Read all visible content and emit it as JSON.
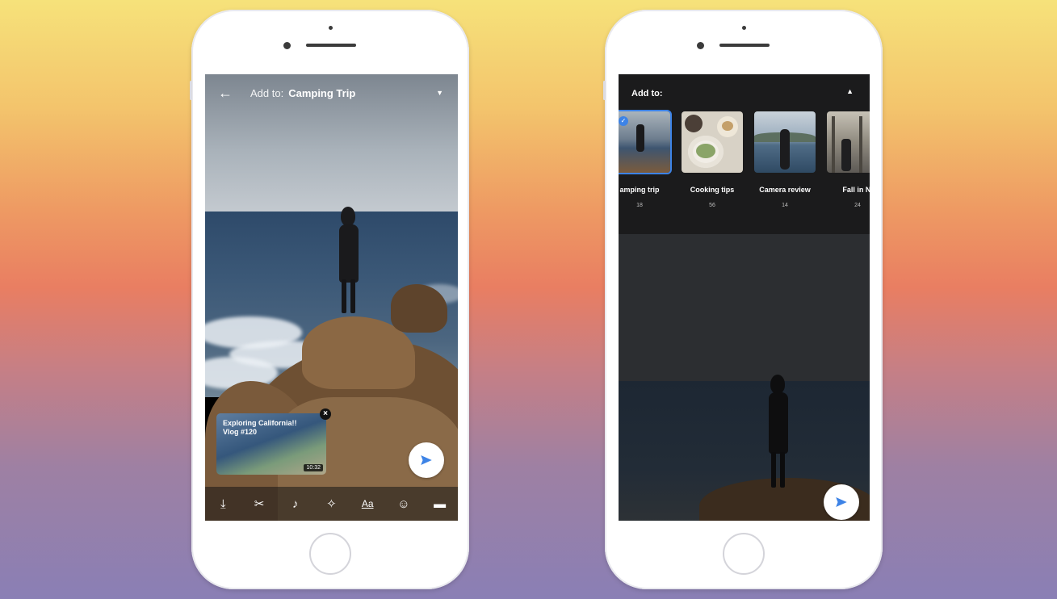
{
  "left_phone": {
    "topbar": {
      "back_icon": "arrow-left-icon",
      "add_to_label": "Add to:",
      "collection": "Camping Trip",
      "dropdown_icon": "caret-down-icon"
    },
    "preview": {
      "title": "Exploring California!! Vlog #120",
      "duration": "10:32",
      "close_icon": "close-icon"
    },
    "send_icon": "send-icon",
    "toolbar": [
      {
        "name": "download-icon",
        "glyph": "⤓"
      },
      {
        "name": "scissors-icon",
        "glyph": "✂"
      },
      {
        "name": "music-note-icon",
        "glyph": "♪"
      },
      {
        "name": "magic-wand-icon",
        "glyph": "✧"
      },
      {
        "name": "text-icon",
        "glyph": "Aa"
      },
      {
        "name": "sticker-icon",
        "glyph": "☺"
      },
      {
        "name": "end-screen-icon",
        "glyph": "▬"
      }
    ]
  },
  "right_phone": {
    "panel": {
      "header": "Add to:",
      "caret_icon": "caret-up-icon"
    },
    "collections": [
      {
        "label": "amping trip",
        "count": "18",
        "selected": true
      },
      {
        "label": "Cooking tips",
        "count": "56",
        "selected": false
      },
      {
        "label": "Camera review",
        "count": "14",
        "selected": false
      },
      {
        "label": "Fall in N'",
        "count": "24",
        "selected": false
      }
    ],
    "send_icon": "send-icon"
  },
  "colors": {
    "accent_blue": "#3d83e6",
    "panel_bg": "#1b1b1c"
  }
}
